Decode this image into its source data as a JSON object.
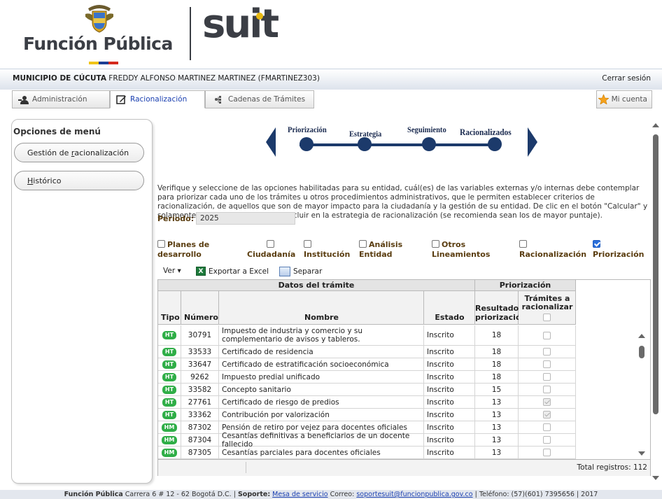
{
  "header": {
    "brand_left": "Función Pública",
    "brand_right": "suit",
    "brand_colors": [
      "#f0c419",
      "#1c3f95",
      "#d52b1e"
    ]
  },
  "topbar": {
    "entity": "MUNICIPIO DE CÚCUTA",
    "user": "FREDDY ALFONSO MARTINEZ MARTINEZ (FMARTINEZ303)",
    "logout": "Cerrar sesión"
  },
  "tabs": [
    {
      "label": "Administración",
      "icon": "user-admin-icon"
    },
    {
      "label": "Racionalización",
      "icon": "edit-icon"
    },
    {
      "label": "Cadenas de Trámites",
      "icon": "chain-icon"
    }
  ],
  "account": {
    "label": "Mi cuenta",
    "icon": "star-icon"
  },
  "side_menu": {
    "title": "Opciones de menú",
    "items": [
      {
        "pre": "Gestión de ",
        "u": "r",
        "post": "acionalización"
      },
      {
        "pre": "",
        "u": "H",
        "post": "istórico"
      }
    ]
  },
  "steps": [
    {
      "label": "Priorización"
    },
    {
      "label": "Estrategia"
    },
    {
      "label": "Seguimiento"
    },
    {
      "label": "Racionalizados"
    }
  ],
  "description": "Verifique y seleccione de las opciones habilitadas para su entidad, cuál(es) de las variables externas y/o internas debe contemplar para priorizar cada uno de los trámites u otros procedimientos administrativos, que le permiten establecer criterios de racionalización, de aquellos que son de mayor impacto para la ciudadanía y la gestión de su entidad. De clic en el botón \"Calcular\" y solamente seleccione los que va a incluir en la estrategia de racionalización (se recomienda sean los de mayor puntaje).",
  "period": {
    "label": "Período:",
    "value": "2025"
  },
  "filters": [
    {
      "line1": "Planes de",
      "line2": "desarrollo",
      "checked": false
    },
    {
      "line1": "",
      "line2": "Ciudadanía",
      "checked": false
    },
    {
      "line1": "",
      "line2": "Institución",
      "checked": false
    },
    {
      "line1": "Análisis",
      "line2": "Entidad",
      "checked": false
    },
    {
      "line1": "Otros",
      "line2": "Lineamientos",
      "checked": false
    },
    {
      "line1": "",
      "line2": "Racionalización",
      "checked": false
    },
    {
      "line1": "",
      "line2": "Priorización",
      "checked": true
    }
  ],
  "toolbar": {
    "view": "Ver ▾",
    "export": "Exportar a Excel",
    "separate": "Separar"
  },
  "grid": {
    "group_headers": {
      "data": "Datos del trámite",
      "prio": "Priorización"
    },
    "columns": {
      "tipo": "Tipo",
      "numero": "Número",
      "nombre": "Nombre",
      "estado": "Estado",
      "resultado_1": "Resultado",
      "resultado_2": "priorización",
      "tramites_1": "Trámites a",
      "tramites_2": "racionalizar"
    },
    "rows": [
      {
        "tipo": "HT",
        "numero": "30791",
        "nombre": "Impuesto de industria y comercio y su complementario de avisos y tableros.",
        "estado": "Inscrito",
        "resultado": "18",
        "checked": false
      },
      {
        "tipo": "HT",
        "numero": "33533",
        "nombre": "Certificado de residencia",
        "estado": "Inscrito",
        "resultado": "18",
        "checked": false
      },
      {
        "tipo": "HT",
        "numero": "33647",
        "nombre": "Certificado de estratificación socioeconómica",
        "estado": "Inscrito",
        "resultado": "18",
        "checked": false
      },
      {
        "tipo": "HT",
        "numero": "9262",
        "nombre": "Impuesto predial unificado",
        "estado": "Inscrito",
        "resultado": "18",
        "checked": false
      },
      {
        "tipo": "HT",
        "numero": "33582",
        "nombre": "Concepto sanitario",
        "estado": "Inscrito",
        "resultado": "15",
        "checked": false
      },
      {
        "tipo": "HT",
        "numero": "27761",
        "nombre": "Certificado de riesgo de predios",
        "estado": "Inscrito",
        "resultado": "13",
        "checked": true
      },
      {
        "tipo": "HT",
        "numero": "33362",
        "nombre": "Contribución por valorización",
        "estado": "Inscrito",
        "resultado": "13",
        "checked": true
      },
      {
        "tipo": "HM",
        "numero": "87302",
        "nombre": "Pensión de retiro por vejez para docentes oficiales",
        "estado": "Inscrito",
        "resultado": "13",
        "checked": false
      },
      {
        "tipo": "HM",
        "numero": "87304",
        "nombre": "Cesantías definitivas a beneficiarios de un docente fallecido",
        "estado": "Inscrito",
        "resultado": "13",
        "checked": false
      },
      {
        "tipo": "HM",
        "numero": "87305",
        "nombre": "Cesantías parciales para docentes oficiales",
        "estado": "Inscrito",
        "resultado": "13",
        "checked": false
      }
    ],
    "total": "Total registros: 112"
  },
  "footer": {
    "org": "Función Pública",
    "address": "Carrera 6 # 12 - 62 Bogotá D.C. |",
    "support_label": "Soporte:",
    "support_link": "Mesa de servicio",
    "mail_label": "Correo:",
    "mail": "soportesuit@funcionpublica.gov.co",
    "phone": "| Teléfono: (57)(601) 7395656 | 2017"
  }
}
